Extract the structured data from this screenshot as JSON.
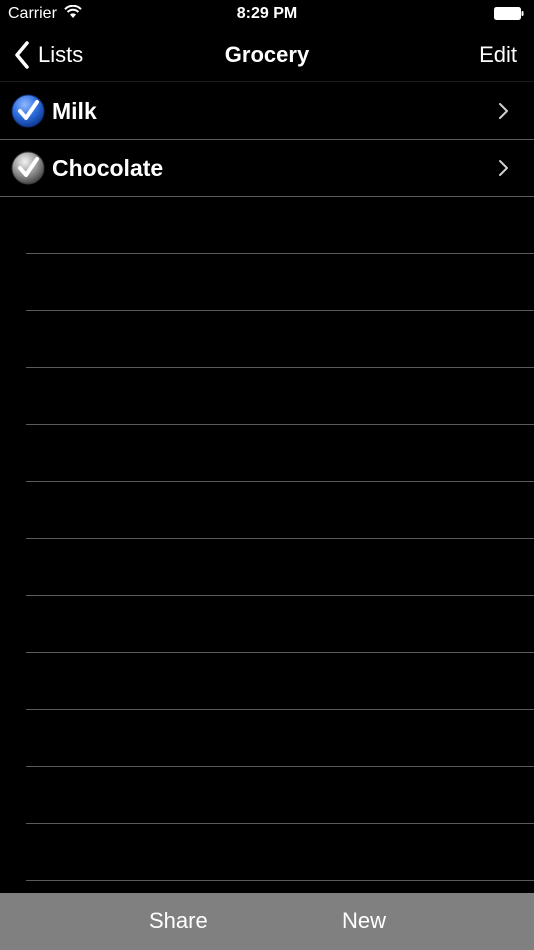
{
  "status_bar": {
    "carrier": "Carrier",
    "time": "8:29 PM",
    "wifi_icon": "wifi-icon",
    "battery_icon": "battery-icon"
  },
  "nav": {
    "back_label": "Lists",
    "back_icon": "chevron-left-icon",
    "title": "Grocery",
    "edit_label": "Edit"
  },
  "items": [
    {
      "label": "Milk",
      "checked": true,
      "check_color": "#2f6fe0",
      "icon": "checkmark-circle-icon"
    },
    {
      "label": "Chocolate",
      "checked": false,
      "check_color": "#9a9a9a",
      "icon": "checkmark-circle-icon"
    }
  ],
  "toolbar": {
    "share_label": "Share",
    "new_label": "New"
  },
  "colors": {
    "background": "#000000",
    "separator": "#5a5a5a",
    "toolbar": "#808080"
  }
}
